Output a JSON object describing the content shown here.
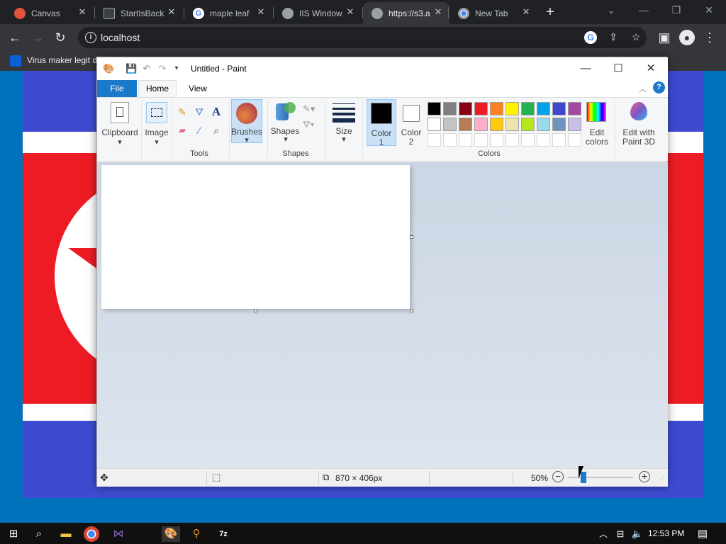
{
  "browser": {
    "tabs": [
      {
        "label": "Canvas",
        "favicon": "canvas-icon",
        "color": "#e0533c"
      },
      {
        "label": "StartIsBack",
        "favicon": "terminal-icon",
        "color": "#3c4043"
      },
      {
        "label": "maple leaf",
        "favicon": "google-icon",
        "color": "#ffffff"
      },
      {
        "label": "IIS Window",
        "favicon": "globe-icon",
        "color": "#9aa0a6"
      },
      {
        "label": "https://s3.a",
        "favicon": "globe-icon",
        "color": "#9aa0a6"
      },
      {
        "label": "New Tab",
        "favicon": "chrome-icon",
        "color": "#9aa0a6"
      }
    ],
    "active_tab": 4,
    "url": "localhost",
    "bookmark": "Virus maker legit d"
  },
  "paint": {
    "title": "Untitled - Paint",
    "tabs": {
      "file": "File",
      "home": "Home",
      "view": "View"
    },
    "ribbon": {
      "clipboard": "Clipboard",
      "image": "Image",
      "tools": "Tools",
      "brushes": "Brushes",
      "shapes_btn": "Shapes",
      "shapes_group": "Shapes",
      "size": "Size",
      "color1_a": "Color",
      "color1_b": "1",
      "color2_a": "Color",
      "color2_b": "2",
      "colors_group": "Colors",
      "edit_a": "Edit",
      "edit_b": "colors",
      "p3d_a": "Edit with",
      "p3d_b": "Paint 3D"
    },
    "palette_row1": [
      "#000000",
      "#7f7f7f",
      "#880015",
      "#ed1c24",
      "#ff7f27",
      "#fff200",
      "#22b14c",
      "#00a2e8",
      "#3f48cc",
      "#a349a4"
    ],
    "palette_row2": [
      "#ffffff",
      "#c3c3c3",
      "#b97a57",
      "#ffaec9",
      "#ffc90e",
      "#efe4b0",
      "#b5e61d",
      "#99d9ea",
      "#7092be",
      "#c8bfe7"
    ],
    "status": {
      "size": "870 × 406px",
      "zoom": "50%"
    }
  },
  "taskbar": {
    "time": "12:53 PM"
  }
}
